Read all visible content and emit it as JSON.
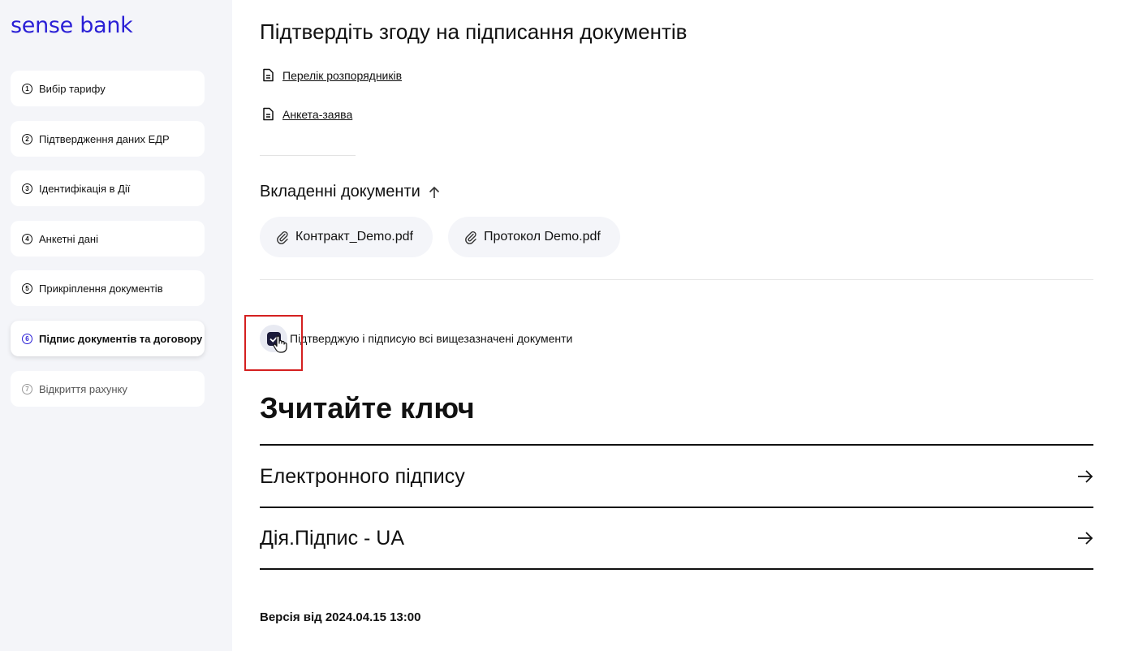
{
  "brand": {
    "logo_text": "sense bank",
    "color": "#2a1fd6"
  },
  "sidebar": {
    "steps": [
      {
        "num": "1",
        "label": "Вибір тарифу"
      },
      {
        "num": "2",
        "label": "Підтвердження даних ЕДР"
      },
      {
        "num": "3",
        "label": "Ідентифікація в Дії"
      },
      {
        "num": "4",
        "label": "Анкетні дані"
      },
      {
        "num": "5",
        "label": "Прикріплення документів"
      },
      {
        "num": "6",
        "label": "Підпис документів та договору"
      },
      {
        "num": "7",
        "label": "Відкриття рахунку"
      }
    ]
  },
  "main": {
    "title": "Підтвердіть згоду на підписання документів",
    "doc_links": [
      "Перелік розпорядників",
      "Анкета-заява"
    ],
    "attached_title": "Вкладенні документи",
    "attachments": [
      "Контракт_Demo.pdf",
      "Протокол Demo.pdf"
    ],
    "confirm_label": "Підтверджую і підписую всі вищезазначені документи",
    "key_title": "Зчитайте ключ",
    "key_options": [
      "Електронного підпису",
      "Дія.Підпис - UA"
    ],
    "version": "Версія від 2024.04.15 13:00"
  }
}
